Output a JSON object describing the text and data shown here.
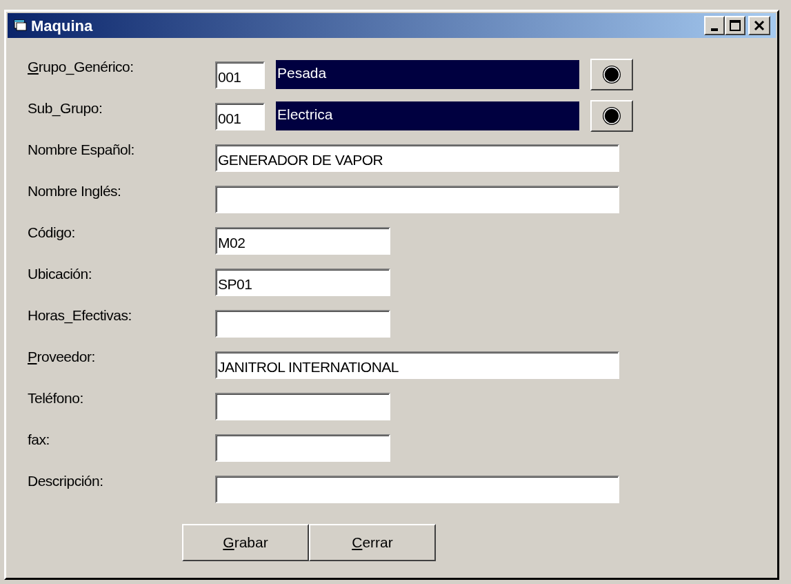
{
  "window": {
    "title": "Maquina"
  },
  "fields": [
    {
      "kind": "lookup",
      "label": "Grupo_Genérico:",
      "mnemonic": true,
      "code": "001",
      "name": {
        "text": "Pesada",
        "selected": true
      }
    },
    {
      "kind": "lookup",
      "label": "Sub_Grupo:",
      "mnemonic": false,
      "code": "001",
      "name": {
        "text": "Electrica",
        "selected": true
      }
    },
    {
      "kind": "long",
      "label": "Nombre Español:",
      "mnemonic": false,
      "value": "GENERADOR DE VAPOR"
    },
    {
      "kind": "long",
      "label": "Nombre Inglés:",
      "mnemonic": false
    },
    {
      "kind": "short",
      "label": "Código:",
      "mnemonic": false,
      "value": "M02"
    },
    {
      "kind": "short",
      "label": "Ubicación:",
      "mnemonic": false,
      "value": "SP01"
    },
    {
      "kind": "short",
      "label": "Horas_Efectivas:",
      "mnemonic": false
    },
    {
      "kind": "long",
      "label": "Proveedor:",
      "mnemonic": true,
      "value": "JANITROL INTERNATIONAL"
    },
    {
      "kind": "short",
      "label": "Teléfono:",
      "mnemonic": false
    },
    {
      "kind": "short",
      "label": "fax:",
      "mnemonic": false
    },
    {
      "kind": "long",
      "label": "Descripción:",
      "mnemonic": false
    }
  ],
  "buttons": [
    {
      "label": "Grabar",
      "mnemonic": true
    },
    {
      "label": "Cerrar",
      "mnemonic": true
    }
  ]
}
